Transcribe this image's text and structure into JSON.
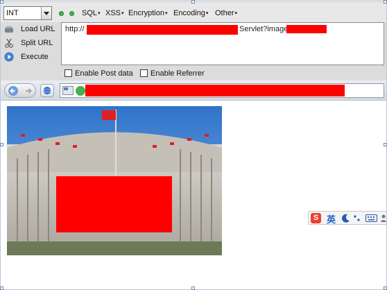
{
  "hackbar": {
    "type_select": {
      "value": "INT"
    },
    "menus": [
      {
        "label": "SQL"
      },
      {
        "label": "XSS"
      },
      {
        "label": "Encryption"
      },
      {
        "label": "Encoding"
      },
      {
        "label": "Other"
      }
    ],
    "side_buttons": {
      "load_url": "Load URL",
      "split_url": "Split URL",
      "execute": "Execute"
    },
    "url": {
      "prefix": "http://",
      "suffix": "Servlet?image"
    },
    "checkboxes": {
      "post_data": "Enable Post data",
      "referrer": "Enable Referrer"
    }
  },
  "ime": {
    "logo": "S",
    "mode": "英"
  },
  "colors": {
    "redaction": "#ff0000",
    "toolbar_top": "#eaeef3",
    "hackbar_bg": "#dcdcdc"
  }
}
